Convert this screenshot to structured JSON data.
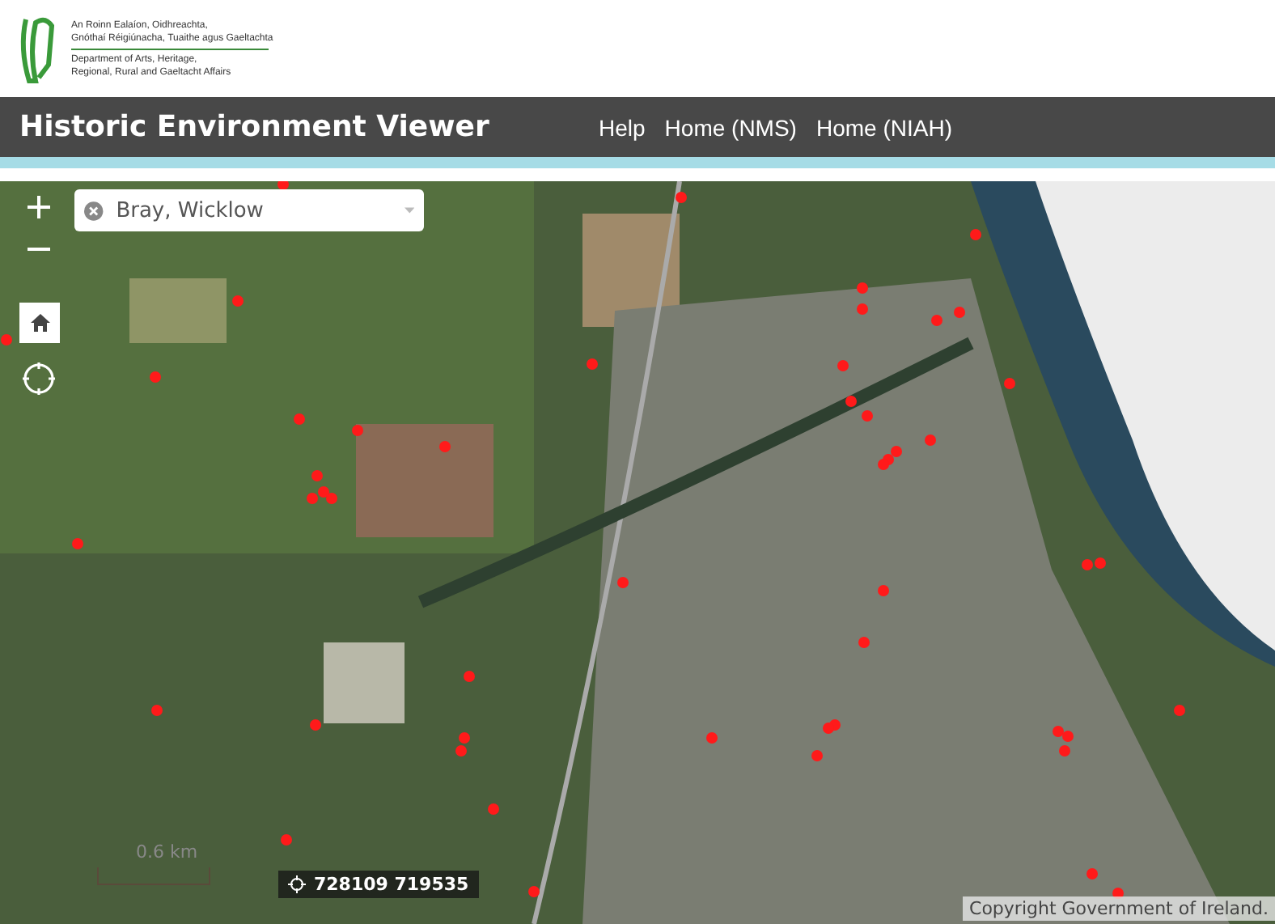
{
  "header": {
    "department_irish": [
      "An Roinn Ealaíon, Oidhreachta,",
      "Gnóthaí Réigiúnacha, Tuaithe agus Gaeltachta"
    ],
    "department_english": [
      "Department of Arts, Heritage,",
      "Regional, Rural and Gaeltacht Affairs"
    ]
  },
  "app_bar": {
    "title": "Historic Environment Viewer",
    "links": [
      "Help",
      "Home (NMS)",
      "Home (NIAH)"
    ]
  },
  "map": {
    "search": {
      "value": "Bray, Wicklow"
    },
    "scale": "0.6 km",
    "coordinates": "728109 719535",
    "attribution": "Copyright Government of Ireland."
  }
}
